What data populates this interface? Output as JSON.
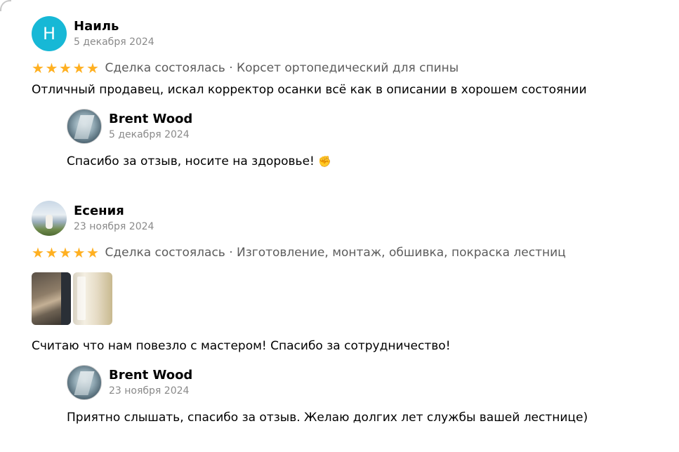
{
  "reviews": [
    {
      "avatar_letter": "Н",
      "author": "Наиль",
      "date": "5 декабря 2024",
      "stars": 5,
      "deal": "Сделка состоялась · Корсет ортопедический для спины",
      "text": "Отличный продавец, искал корректор осанки всё как в описании в хорошем состоянии",
      "reply": {
        "author": "Brent Wood",
        "date": "5 декабря 2024",
        "text": "Спасибо за отзыв, носите на здоровье!",
        "emoji": "✊"
      }
    },
    {
      "author": "Есения",
      "date": "23 ноября 2024",
      "stars": 5,
      "deal": "Сделка состоялась · Изготовление, монтаж, обшивка, покраска лестниц",
      "text": "Считаю что нам повезло с мастером! Спасибо за сотрудничество!",
      "reply": {
        "author": "Brent Wood",
        "date": "23 ноября 2024",
        "text": "Приятно слышать, спасибо за отзыв. Желаю долгих лет службы вашей лестнице)"
      }
    }
  ],
  "colors": {
    "star": "#ffb021",
    "avatar_letter_bg": "#17b8d6",
    "muted_text": "#8a8a8a"
  },
  "icons": {
    "star": "star-icon",
    "emoji": "raised-fist-icon"
  }
}
